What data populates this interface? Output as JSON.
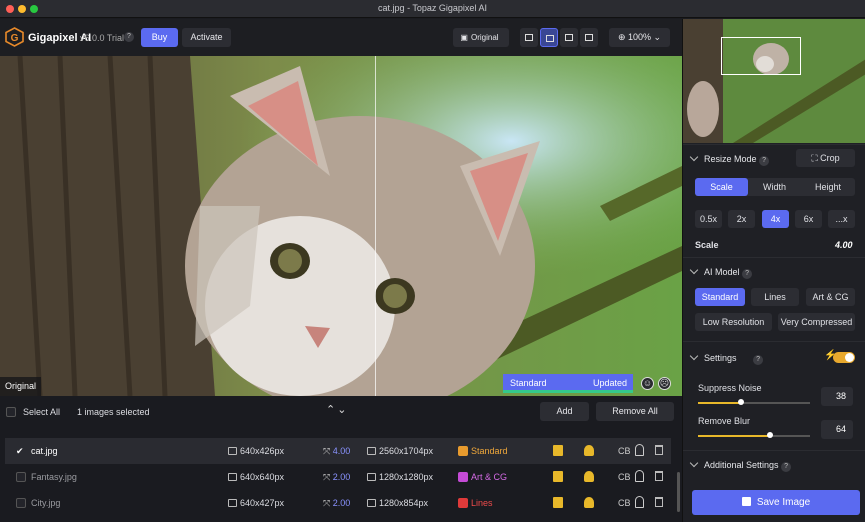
{
  "window": {
    "title": "cat.jpg - Topaz Gigapixel AI"
  },
  "header": {
    "app_name": "Gigapixel AI",
    "version": "v6.0.0 Trial",
    "help": "?",
    "buy_label": "Buy",
    "activate_label": "Activate",
    "original_label": "Original",
    "zoom_label": "100%"
  },
  "preview": {
    "original_label": "Original",
    "model_label": "Standard",
    "status_label": "Updated"
  },
  "list": {
    "select_all": "Select All",
    "selected_count": "1 images selected",
    "add_label": "Add",
    "remove_all_label": "Remove All",
    "rows": [
      {
        "name": "cat.jpg",
        "input": "640x426px",
        "scale": "4.00",
        "output": "2560x1704px",
        "model": "Standard",
        "cb": "CB"
      },
      {
        "name": "Fantasy.jpg",
        "input": "640x640px",
        "scale": "2.00",
        "output": "1280x1280px",
        "model": "Art & CG",
        "cb": "CB"
      },
      {
        "name": "City.jpg",
        "input": "640x427px",
        "scale": "2.00",
        "output": "1280x854px",
        "model": "Lines",
        "cb": "CB"
      }
    ]
  },
  "sidebar": {
    "resize_mode": "Resize Mode",
    "crop_label": "Crop",
    "modes": [
      "Scale",
      "Width",
      "Height"
    ],
    "scales": [
      "0.5x",
      "2x",
      "4x",
      "6x",
      "...x"
    ],
    "scale_label": "Scale",
    "scale_value": "4.00",
    "ai_model": "AI Model",
    "models": [
      "Standard",
      "Lines",
      "Art & CG",
      "Low Resolution",
      "Very Compressed"
    ],
    "settings": "Settings",
    "suppress_noise": "Suppress Noise",
    "suppress_noise_value": "38",
    "remove_blur": "Remove Blur",
    "remove_blur_value": "64",
    "additional_settings": "Additional Settings",
    "save_label": "Save Image"
  }
}
